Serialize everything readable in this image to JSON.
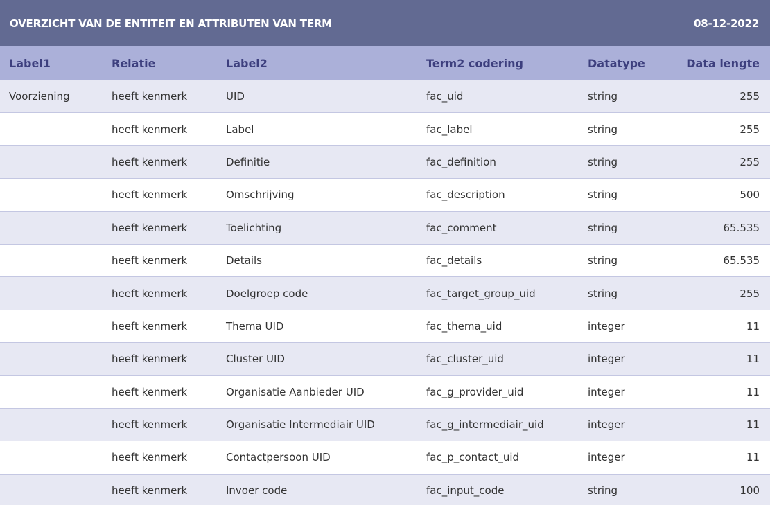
{
  "header": {
    "title": "OVERZICHT VAN DE ENTITEIT EN ATTRIBUTEN VAN TERM",
    "date": "08-12-2022"
  },
  "columns": [
    "Label1",
    "Relatie",
    "Label2",
    "Term2 codering",
    "Datatype",
    "Data lengte"
  ],
  "rows": [
    [
      "Voorziening",
      "heeft kenmerk",
      "UID",
      "fac_uid",
      "string",
      "255"
    ],
    [
      "",
      "heeft kenmerk",
      "Label",
      "fac_label",
      "string",
      "255"
    ],
    [
      "",
      "heeft kenmerk",
      "Definitie",
      "fac_definition",
      "string",
      "255"
    ],
    [
      "",
      "heeft kenmerk",
      "Omschrijving",
      "fac_description",
      "string",
      "500"
    ],
    [
      "",
      "heeft kenmerk",
      "Toelichting",
      "fac_comment",
      "string",
      "65.535"
    ],
    [
      "",
      "heeft kenmerk",
      "Details",
      "fac_details",
      "string",
      "65.535"
    ],
    [
      "",
      "heeft kenmerk",
      "Doelgroep code",
      "fac_target_group_uid",
      "string",
      "255"
    ],
    [
      "",
      "heeft kenmerk",
      "Thema UID",
      "fac_thema_uid",
      "integer",
      "11"
    ],
    [
      "",
      "heeft kenmerk",
      "Cluster UID",
      "fac_cluster_uid",
      "integer",
      "11"
    ],
    [
      "",
      "heeft kenmerk",
      "Organisatie Aanbieder UID",
      "fac_g_provider_uid",
      "integer",
      "11"
    ],
    [
      "",
      "heeft kenmerk",
      "Organisatie Intermediair UID",
      "fac_g_intermediair_uid",
      "integer",
      "11"
    ],
    [
      "",
      "heeft kenmerk",
      "Contactpersoon UID",
      "fac_p_contact_uid",
      "integer",
      "11"
    ],
    [
      "",
      "heeft kenmerk",
      "Invoer code",
      "fac_input_code",
      "string",
      "100"
    ]
  ],
  "colors": {
    "title_bg": "#626a92",
    "header_bg": "#abb0d9",
    "header_text": "#3d3f7e",
    "row_alt_bg": "#e7e8f3",
    "row_border": "#c4c7e2"
  }
}
